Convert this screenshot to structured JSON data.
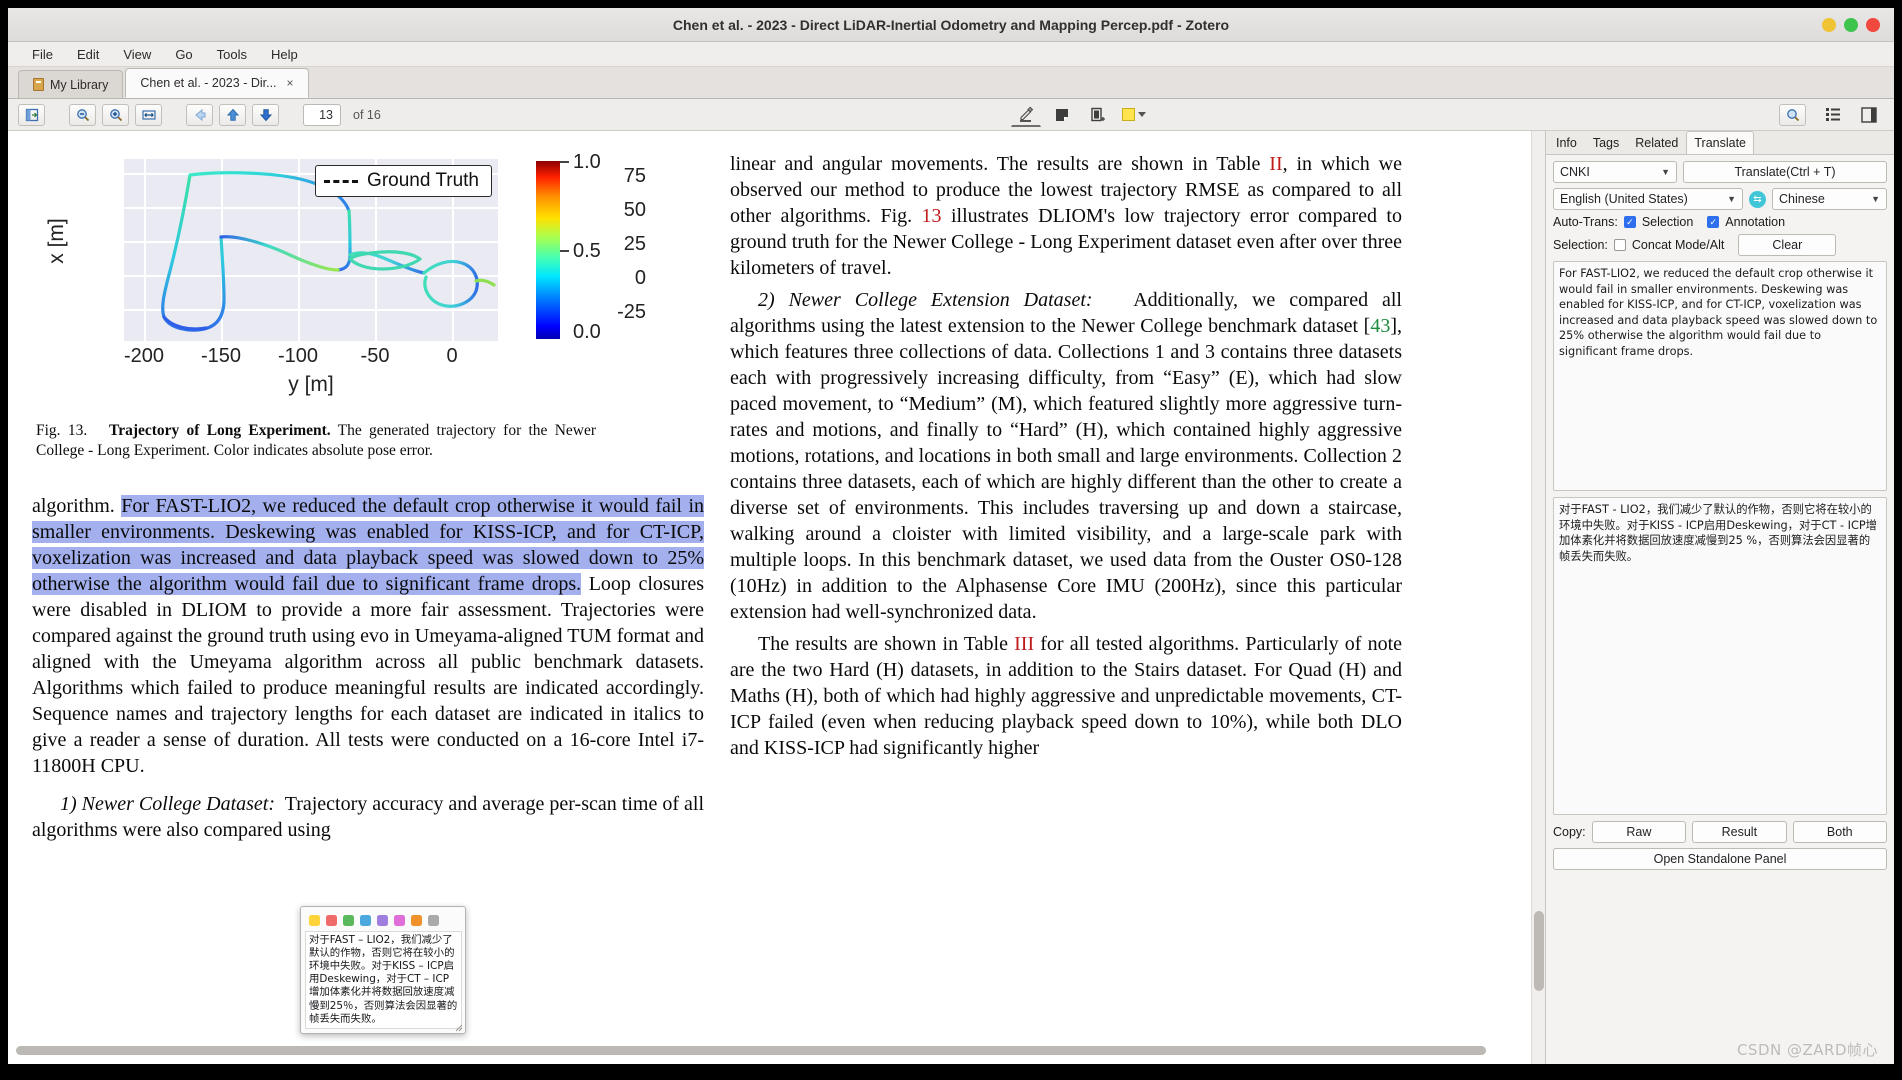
{
  "window": {
    "title": "Chen et al. - 2023 - Direct LiDAR-Inertial Odometry and Mapping Percep.pdf - Zotero",
    "buttons": {
      "minimize": "minimize",
      "maximize": "maximize",
      "close": "close"
    },
    "colors": {
      "minimize": "#f0c335",
      "maximize": "#3ec44c",
      "close": "#f0483e"
    }
  },
  "menu": {
    "items": [
      "File",
      "Edit",
      "View",
      "Go",
      "Tools",
      "Help"
    ]
  },
  "tabs": [
    {
      "label": "My Library",
      "icon": "library-icon",
      "active": false,
      "closable": false
    },
    {
      "label": "Chen et al. - 2023 - Dir...",
      "icon": "",
      "active": true,
      "closable": true,
      "close_label": "×"
    }
  ],
  "toolbar": {
    "sidebar_toggle": "toggle-sidebar-icon",
    "zoom_out": "zoom-out-icon",
    "zoom_in": "zoom-in-icon",
    "fit_width": "fit-width-icon",
    "back": "navigate-back-icon",
    "page_up": "page-up-icon",
    "page_down": "page-down-icon",
    "page_number": "13",
    "page_of": "of 16",
    "highlight_tool": "highlight-text-icon",
    "note_tool": "add-note-icon",
    "area_tool": "select-area-icon",
    "color_swatch": "#ffe44d",
    "find": "find-icon",
    "view_mode_list": "view-list-icon",
    "view_mode_panel": "toggle-right-panel-icon"
  },
  "figure": {
    "caption_prefix": "Fig. 13.",
    "caption_bold": "Trajectory of Long Experiment.",
    "caption_rest": "The generated trajectory for the Newer College - Long Experiment. Color indicates absolute pose error."
  },
  "chart_data": {
    "type": "line",
    "title": "",
    "xlabel": "y [m]",
    "ylabel": "x [m]",
    "xlim": [
      -225,
      20
    ],
    "ylim": [
      -38,
      92
    ],
    "xticks": [
      -200,
      -150,
      -100,
      -50,
      0
    ],
    "yticks": [
      75,
      50,
      25,
      0,
      -25
    ],
    "grid": true,
    "legend": {
      "entries": [
        "Ground Truth"
      ],
      "position": "upper right",
      "linestyle": "dashed"
    },
    "colorbar": {
      "label": "",
      "ticks": [
        0.0,
        0.5,
        1.0
      ],
      "tick_labels": [
        "0.0",
        "0.5",
        "1.0"
      ],
      "vmin": 0.0,
      "vmax": 1.0,
      "colormap": "jet",
      "meaning": "absolute pose error"
    },
    "series": [
      {
        "name": "Ground Truth",
        "comment": "closed-loop trajectory, colored by absolute pose error (jet colormap)",
        "x": [
          -213,
          -216,
          -218,
          -215,
          -208,
          -199,
          -190,
          -183,
          -178,
          -174,
          -170,
          -166,
          -163,
          -160,
          -157,
          -154,
          -151,
          -148,
          -146,
          -147,
          -150,
          -154,
          -158,
          -162,
          -166,
          -169,
          -171,
          -168,
          -160,
          -148,
          -134,
          -120,
          -106,
          -94,
          -84,
          -78,
          -74,
          -72,
          -73,
          -78,
          -86,
          -96,
          -108,
          -120,
          -131,
          -140,
          -147,
          -152,
          -155,
          -157,
          -158,
          -157,
          -153,
          -146,
          -137,
          -127,
          -117,
          -108,
          -101,
          -96,
          -93,
          -92,
          -93,
          -95,
          -98,
          -99,
          -98,
          -95,
          -90,
          -83,
          -76,
          -70,
          -66,
          -64,
          -64,
          -67,
          -72,
          -78,
          -84,
          -88,
          -90,
          -89,
          -85,
          -79,
          -72,
          -64,
          -57,
          -52,
          -49,
          -48,
          -50,
          -54,
          -59,
          -64,
          -68,
          -70,
          -69,
          -65,
          -59,
          -52,
          -45,
          -39,
          -34,
          -31,
          -30,
          -32,
          -36,
          -41,
          -46,
          -50,
          -52,
          -51,
          -47,
          -42,
          -36,
          -30,
          -25,
          -22,
          -21,
          -23,
          -27,
          -32,
          -37,
          -41,
          -43,
          -42,
          -38,
          -32,
          -25,
          -18,
          -12,
          -8,
          -6,
          -7,
          -10,
          -14,
          -17,
          -18,
          -15
        ],
        "y": [
          -12,
          -20,
          -27,
          -33,
          -36,
          -36,
          -33,
          -27,
          -19,
          -9,
          2,
          13,
          22,
          27,
          28,
          26,
          20,
          11,
          1,
          -8,
          -14,
          -15,
          -12,
          -6,
          3,
          13,
          24,
          35,
          46,
          56,
          64,
          71,
          76,
          80,
          83,
          85,
          85,
          84,
          82,
          79,
          76,
          73,
          70,
          67,
          64,
          61,
          59,
          57,
          55,
          53,
          51,
          48,
          45,
          42,
          39,
          36,
          33,
          30,
          27,
          24,
          21,
          18,
          16,
          15,
          15,
          16,
          18,
          20,
          22,
          24,
          26,
          27,
          27,
          26,
          24,
          21,
          19,
          18,
          18,
          20,
          23,
          26,
          29,
          31,
          32,
          32,
          31,
          29,
          27,
          25,
          24,
          24,
          25,
          27,
          29,
          31,
          33,
          34,
          34,
          33,
          31,
          29,
          28,
          27,
          27,
          28,
          30,
          32,
          33,
          34,
          34,
          33,
          31,
          29,
          27,
          25,
          23,
          22,
          21,
          21,
          22,
          23,
          24,
          25,
          25,
          24,
          22,
          19,
          16,
          13,
          10,
          7,
          5,
          3,
          2,
          2,
          3,
          5
        ]
      }
    ]
  },
  "left_column": {
    "paragraphs": [
      {
        "id": "p-algorithm",
        "segments": [
          {
            "text": "algorithm. ",
            "highlight": false
          },
          {
            "text": "For FAST-LIO2, we reduced the default crop otherwise it would fail in smaller environments. Deskewing was enabled for KISS-ICP, and for CT-ICP, voxelization was increased and data playback speed was slowed down to 25% otherwise the algorithm would fail due to significant frame drops.",
            "highlight": true
          },
          {
            "text": " Loop closures were disabled in DLIOM to provide a more fair assessment. Trajectories were compared against the ground truth using evo in Umeyama-aligned TUM format and aligned with the Umeyama algorithm across all public benchmark datasets. Algorithms which failed to produce meaningful results are indicated accordingly. Sequence names and trajectory lengths for each dataset are indicated in italics to give a reader a sense of duration. All tests were conducted on a 16-core Intel i7-11800H CPU.",
            "highlight": false
          }
        ]
      },
      {
        "id": "p-newer-college",
        "italic_lead": "1) Newer College Dataset:",
        "segments": [
          {
            "text": "Trajectory accuracy and average per-scan time of all algorithms were also compared using",
            "highlight": false
          }
        ]
      }
    ]
  },
  "right_column": {
    "paragraphs": [
      {
        "id": "p-linear",
        "text_before_ref": "linear and angular movements. The results are shown in Table ",
        "ref1": "II",
        "text_mid": ", in which we observed our method to produce the lowest trajectory RMSE as compared to all other algorithms. Fig. ",
        "ref2": "13",
        "text_after": " illustrates DLIOM's low trajectory error compared to ground truth for the Newer College - Long Experiment dataset even after over three kilometers of travel."
      },
      {
        "id": "p-extension",
        "italic_lead": "2) Newer College Extension Dataset:",
        "text_before_ref": "Additionally, we compared all algorithms using the latest extension to the Newer College benchmark dataset [",
        "ref1": "43",
        "text_after": "], which features three collections of data. Collections 1 and 3 contains three datasets each with progressively increasing difficulty, from “Easy” (E), which had slow paced movement, to “Medium” (M), which featured slightly more aggressive turn-rates and motions, and finally to “Hard” (H), which contained highly aggressive motions, rotations, and locations in both small and large environments. Collection 2 contains three datasets, each of which are highly different than the other to create a diverse set of environments. This includes traversing up and down a staircase, walking around a cloister with limited visibility, and a large-scale park with multiple loops. In this benchmark dataset, we used data from the Ouster OS0-128 (10Hz) in addition to the Alphasense Core IMU (200Hz), since this particular extension had well-synchronized data."
      },
      {
        "id": "p-results",
        "text_before_ref": "The results are shown in Table ",
        "ref1": "III",
        "text_after": " for all tested algorithms. Particularly of note are the two Hard (H) datasets, in addition to the Stairs dataset. For Quad (H) and Maths (H), both of which had highly aggressive and unpredictable movements, CT-ICP failed (even when reducing playback speed down to 10%), while both DLO and KISS-ICP had significantly higher"
      }
    ]
  },
  "popup": {
    "name": "annotation-color-popup",
    "swatches": [
      "#ffd43b",
      "#f06a6a",
      "#5cb85c",
      "#4aa8dd",
      "#a07ee0",
      "#e06ed8",
      "#f0922b",
      "#aaaaaa"
    ],
    "text": "对于FAST – LIO2，我们减少了默认的作物，否则它将在较小的环境中失败。对于KISS – ICP启用Deskewing，对于CT – ICP增加体素化并将数据回放速度减慢到25％，否则算法会因显著的帧丢失而失败。"
  },
  "side_panel": {
    "tabs": [
      {
        "label": "Info",
        "active": false
      },
      {
        "label": "Tags",
        "active": false
      },
      {
        "label": "Related",
        "active": false
      },
      {
        "label": "Translate",
        "active": true
      }
    ],
    "service": {
      "value": "CNKI",
      "chevron": "chevron-down-icon"
    },
    "translate_button": "Translate(Ctrl + T)",
    "source_lang": {
      "value": "English (United States)",
      "chevron": "chevron-down-icon"
    },
    "swap_icon": "swap-languages-icon",
    "target_lang": {
      "value": "Chinese",
      "chevron": "chevron-down-icon"
    },
    "auto_trans_label": "Auto-Trans:",
    "auto_trans_selection": {
      "label": "Selection",
      "checked": true
    },
    "auto_trans_annotation": {
      "label": "Annotation",
      "checked": true
    },
    "selection_label": "Selection:",
    "concat_mode": {
      "label": "Concat Mode/Alt",
      "checked": false
    },
    "clear_button": "Clear",
    "source_text": "For FAST-LIO2, we reduced the default crop otherwise it would fail in smaller environments. Deskewing was enabled for KISS-ICP, and for CT-ICP, voxelization was increased and data playback speed was slowed down to 25% otherwise the algorithm would fail due to significant frame drops.",
    "result_text": "对于FAST - LIO2，我们减少了默认的作物，否则它将在较小的环境中失败。对于KISS - ICP启用Deskewing，对于CT - ICP增加体素化并将数据回放速度减慢到25 %，否则算法会因显著的帧丢失而失败。",
    "copy_label": "Copy:",
    "copy_raw": "Raw",
    "copy_result": "Result",
    "copy_both": "Both",
    "standalone_button": "Open Standalone Panel"
  },
  "watermark": "CSDN @ZARD帧心"
}
